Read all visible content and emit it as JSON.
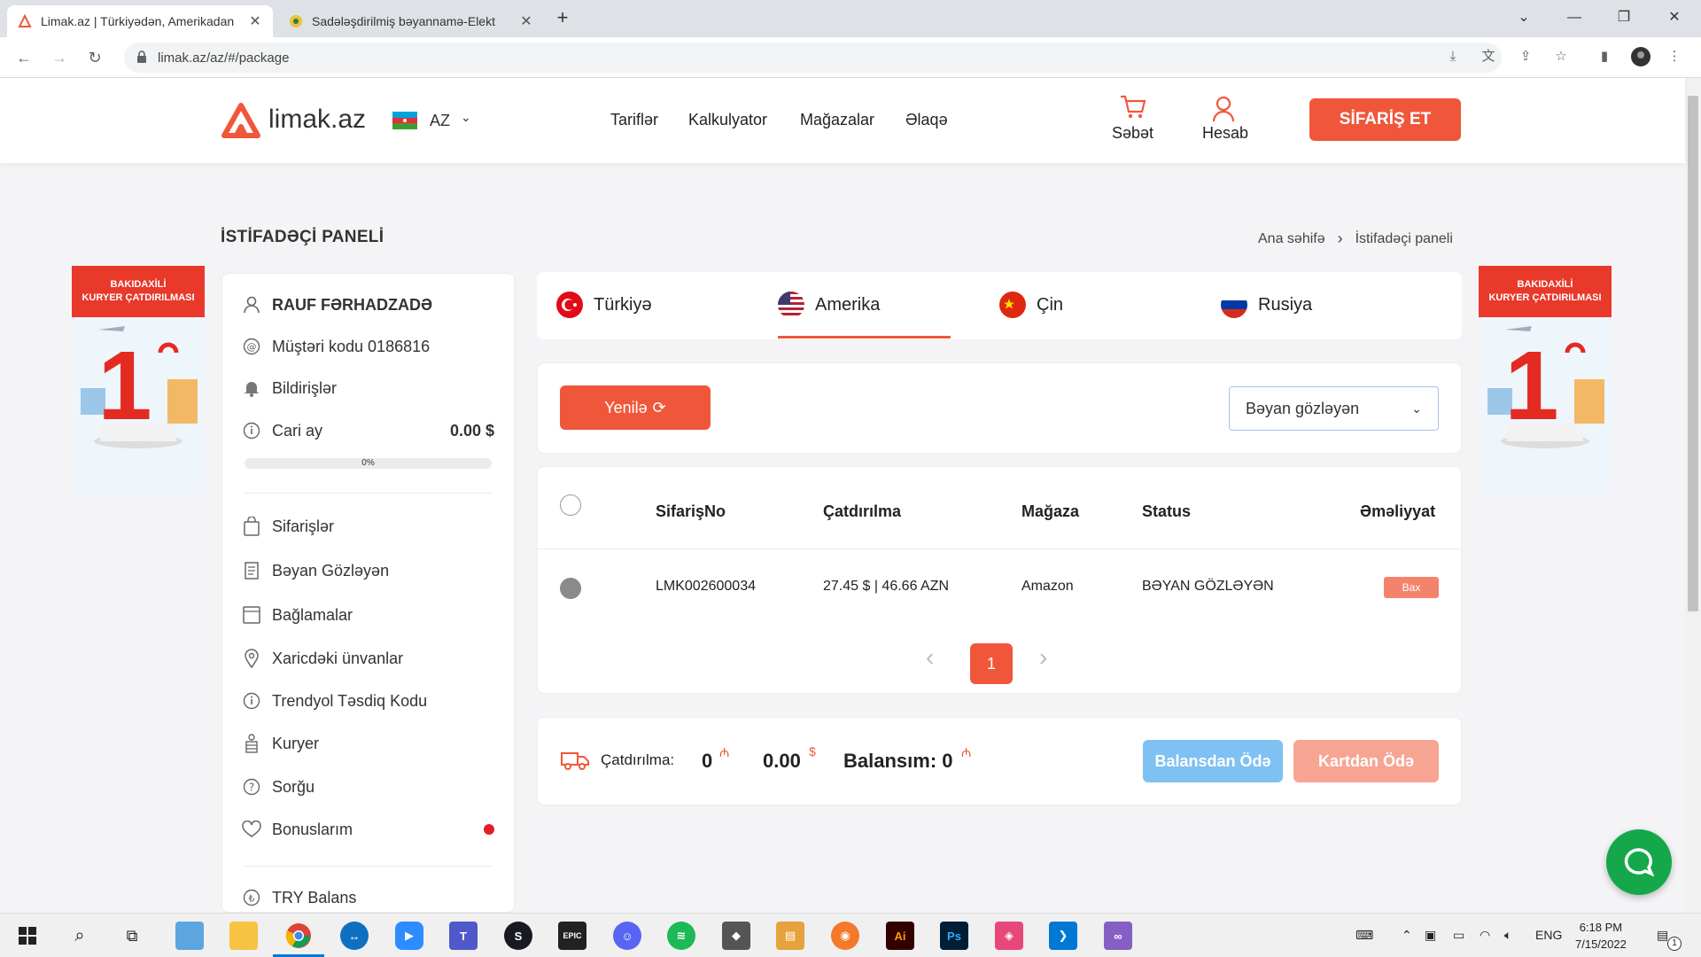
{
  "browser": {
    "tabs": [
      {
        "title": "Limak.az | Türkiyədən, Amerikadan",
        "active": true
      },
      {
        "title": "Sadələşdirilmiş bəyannamə-Elekt",
        "active": false
      }
    ],
    "url": "limak.az/az/#/package",
    "new_tab": "+"
  },
  "header": {
    "logo": "limak.az",
    "language": "AZ",
    "nav": [
      "Tariflər",
      "Kalkulyator",
      "Mağazalar",
      "Əlaqə"
    ],
    "cart_label": "Səbət",
    "account_label": "Hesab",
    "order_button": "SİFARİŞ ET"
  },
  "page": {
    "title": "İSTİFADƏÇİ PANELİ",
    "breadcrumb": [
      "Ana səhifə",
      "İstifadəçi paneli"
    ]
  },
  "ad": {
    "line1": "BAKIDAXİLİ",
    "line2": "KURYER ÇATDIRILMASI",
    "price": "1"
  },
  "sidebar": {
    "user_name": "RAUF FƏRHADZADƏ",
    "customer_code": "Müştəri kodu 0186816",
    "notifications": "Bildirişlər",
    "current_month_label": "Cari ay",
    "current_month_value": "0.00 $",
    "progress_label": "0%",
    "progress_value": 0,
    "items": [
      {
        "label": "Sifarişlər",
        "icon": "bag-icon"
      },
      {
        "label": "Bəyan Gözləyən",
        "icon": "document-icon"
      },
      {
        "label": "Bağlamalar",
        "icon": "box-icon"
      },
      {
        "label": "Xaricdəki ünvanlar",
        "icon": "location-icon"
      },
      {
        "label": "Trendyol Təsdiq Kodu",
        "icon": "info-icon"
      },
      {
        "label": "Kuryer",
        "icon": "courier-icon"
      },
      {
        "label": "Sorğu",
        "icon": "question-icon"
      },
      {
        "label": "Bonuslarım",
        "icon": "heart-icon"
      }
    ],
    "try_balance": "TRY Balans"
  },
  "countries": {
    "tabs": [
      "Türkiyə",
      "Amerika",
      "Çin",
      "Rusiya"
    ],
    "active": "Amerika"
  },
  "filter": {
    "refresh_button": "Yenilə",
    "status_selected": "Bəyan gözləyən"
  },
  "table": {
    "headers": [
      "SifarişNo",
      "Çatdırılma",
      "Mağaza",
      "Status",
      "Əməliyyat"
    ],
    "rows": [
      {
        "order_no": "LMK002600034",
        "delivery": "27.45 $ | 46.66 AZN",
        "store": "Amazon",
        "status": "BƏYAN GÖZLƏYƏN",
        "action": "Bax"
      }
    ],
    "current_page": "1"
  },
  "payment": {
    "delivery_label": "Çatdırılma:",
    "delivery_azn": "0",
    "delivery_usd": "0.00",
    "balance_label": "Balansım: 0",
    "pay_from_balance": "Balansdan Ödə",
    "pay_by_card": "Kartdan Ödə"
  },
  "taskbar": {
    "language": "ENG",
    "time": "6:18 PM",
    "date": "7/15/2022",
    "notification_count": "1"
  },
  "colors": {
    "accent": "#f0573a",
    "balance_button": "#7fc1f2",
    "card_button": "#f7a592"
  }
}
